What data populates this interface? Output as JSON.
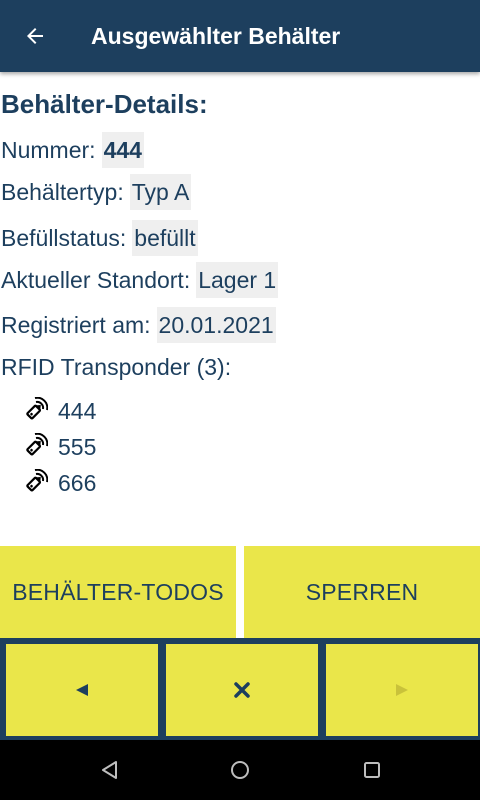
{
  "header": {
    "title": "Ausgewählter Behälter",
    "back_icon": "arrow-left-icon"
  },
  "details": {
    "section_title": "Behälter-Details:",
    "fields": [
      {
        "label": "Nummer:",
        "value": "444"
      },
      {
        "label": "Behältertyp:",
        "value": "Typ A"
      },
      {
        "label": "Befüllstatus:",
        "value": "befüllt"
      },
      {
        "label": "Aktueller Standort:",
        "value": "Lager 1"
      },
      {
        "label": "Registriert am:",
        "value": "20.01.2021"
      }
    ]
  },
  "rfid": {
    "title": "RFID Transponder (3):",
    "tags": [
      "444",
      "555",
      "666"
    ],
    "icon": "rfid-tag-icon"
  },
  "actions": {
    "todos_label": "BEHÄLTER-TODOS",
    "lock_label": "SPERREN"
  },
  "navigation": {
    "prev_icon": "triangle-left-icon",
    "close_icon": "close-icon",
    "next_icon": "triangle-right-icon"
  },
  "system_bar": {
    "back_icon": "android-back-icon",
    "home_icon": "android-home-icon",
    "recents_icon": "android-recents-icon"
  },
  "colors": {
    "primary": "#1d3f5e",
    "accent": "#eae64a",
    "value_bg": "#efefef"
  }
}
